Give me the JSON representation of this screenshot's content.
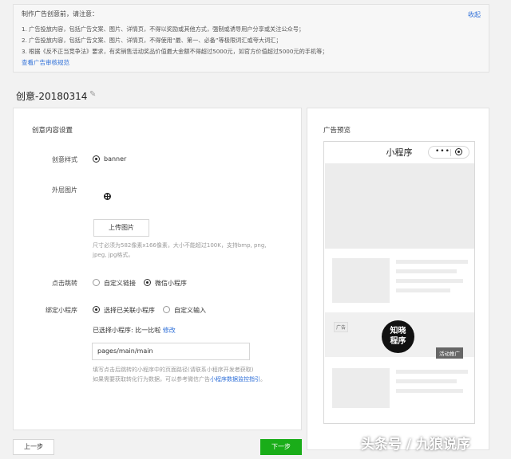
{
  "notice": {
    "title": "制作广告创意前，请注意：",
    "collapse": "收起",
    "lines": [
      "1. 广告投放内容，包括广告文案、图片、详情页，不得以奖励或其他方式，强制或诱导用户分享或关注公众号；",
      "2. 广告投放内容，包括广告文案、图片、详情页，不得使用“最、第一、必备”等极限词汇或夸大词汇；",
      "3. 根据《反不正当竞争法》要求，有奖销售活动奖品价值最大金额不得超过5000元，如官方价值超过5000元的手机等；"
    ],
    "link": "查看广告审核规范"
  },
  "creative": {
    "title": "创意-20180314"
  },
  "settings": {
    "section_title": "创意内容设置",
    "style_label": "创意样式",
    "style_option": "banner",
    "image_label": "外层图片",
    "upload_button": "上传图片",
    "upload_hint_1": "尺寸必须为582像素x166像素，大小不能超过100K，支持bmp, png,",
    "upload_hint_2": "jpeg, jpg格式。",
    "jump_label": "点击跳转",
    "jump_options": [
      "自定义链接",
      "微信小程序"
    ],
    "bind_label": "绑定小程序",
    "bind_options": [
      "选择已关联小程序",
      "自定义输入"
    ],
    "selected_prefix": "已选择小程序: 比一比啦",
    "modify_link": "修改",
    "path_value": "pages/main/main",
    "path_hint_1": "填写点击后跳转的小程序中的页面路径(请联系小程序开发者获取)",
    "path_hint_2": "如果需要获取转化行为数据，可以参考微信广告",
    "path_hint_link": "小程序数据监控指引",
    "path_hint_end": "。"
  },
  "footer": {
    "prev": "上一步",
    "next": "下一步"
  },
  "preview": {
    "section_title": "广告预览",
    "phone_title": "小程序",
    "capsule_dots": "•••",
    "ad_tag": "广告",
    "ad_logo_line1": "知晓",
    "ad_logo_line2": "程序",
    "ad_badge": "活动推广"
  },
  "watermark": "头条号 / 九狼说序"
}
